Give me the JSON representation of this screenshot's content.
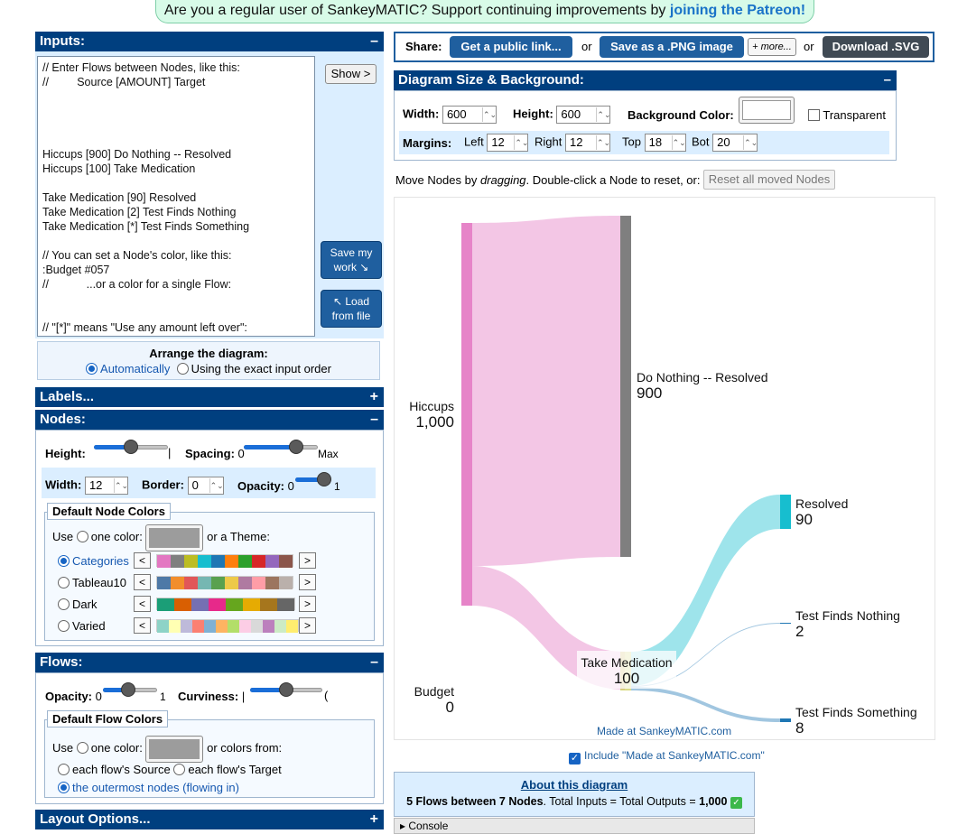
{
  "banner": {
    "prefix": "Are you a regular user of SankeyMATIC? Support continuing improvements by ",
    "link": "joining the Patreon!"
  },
  "inputs": {
    "title": "Inputs:",
    "toggle": "–",
    "flows_text": "// Enter Flows between Nodes, like this:\n//         Source [AMOUNT] Target\n\n\n\n\nHiccups [900] Do Nothing -- Resolved\nHiccups [100] Take Medication\n\nTake Medication [90] Resolved\nTake Medication [2] Test Finds Nothing\nTake Medication [*] Test Finds Something\n\n// You can set a Node's color, like this:\n:Budget #057\n//            ...or a color for a single Flow:\n\n\n// \"[*]\" means \"Use any amount left over\":",
    "show_button": "Show >",
    "save_button": "Save my work ↘",
    "load_button": "↖ Load from file"
  },
  "arrange": {
    "title": "Arrange the diagram:",
    "option_auto": "Automatically",
    "option_exact": "Using the exact input order"
  },
  "labels_panel": {
    "title": "Labels...",
    "toggle": "+"
  },
  "nodes_panel": {
    "title": "Nodes:",
    "toggle": "–",
    "height_label": "Height:",
    "height_value": 0.5,
    "spacing_label": "Spacing:",
    "spacing_min": "0",
    "spacing_max": "Max",
    "spacing_value": 0.75,
    "width_label": "Width:",
    "width_value": "12",
    "border_label": "Border:",
    "border_value": "0",
    "opacity_label": "Opacity:",
    "opacity_min": "0",
    "opacity_max": "1",
    "opacity_value": 1.0,
    "colors_legend": "Default Node Colors",
    "use_label": "Use",
    "one_color_label": "one color:",
    "theme_label": "or a Theme:",
    "themes": [
      {
        "name": "Categories",
        "selected": true,
        "colors": [
          "#e377c2",
          "#7f7f7f",
          "#bcbd22",
          "#17becf",
          "#1f77b4",
          "#ff7f0e",
          "#2ca02c",
          "#d62728",
          "#9467bd",
          "#8c564b"
        ]
      },
      {
        "name": "Tableau10",
        "selected": false,
        "colors": [
          "#4e79a7",
          "#f28e2c",
          "#e15759",
          "#76b7b2",
          "#59a14f",
          "#edc949",
          "#af7aa1",
          "#ff9da7",
          "#9c755f",
          "#bab0ab"
        ]
      },
      {
        "name": "Dark",
        "selected": false,
        "colors": [
          "#1b9e77",
          "#d95f02",
          "#7570b3",
          "#e7298a",
          "#66a61e",
          "#e6ab02",
          "#a6761d",
          "#666666"
        ]
      },
      {
        "name": "Varied",
        "selected": false,
        "colors": [
          "#8dd3c7",
          "#ffffb3",
          "#bebada",
          "#fb8072",
          "#80b1d3",
          "#fdb462",
          "#b3de69",
          "#fccde5",
          "#d9d9d9",
          "#bc80bd",
          "#ccebc5",
          "#ffed6f"
        ]
      }
    ]
  },
  "flows_panel": {
    "title": "Flows:",
    "toggle": "–",
    "opacity_label": "Opacity:",
    "opacity_min": "0",
    "opacity_max": "1",
    "opacity_value": 0.45,
    "curviness_label": "Curviness:",
    "curviness_min": "|",
    "curviness_max": "(",
    "curviness_value": 0.5,
    "colors_legend": "Default Flow Colors",
    "use_label": "Use",
    "one_color_label": "one color:",
    "colors_from_label": "or colors from:",
    "option_source": "each flow's Source",
    "option_target": "each flow's Target",
    "option_outermost": "the outermost nodes (flowing in)"
  },
  "layout_panel": {
    "title": "Layout Options...",
    "toggle": "+"
  },
  "share": {
    "label": "Share:",
    "public_link": "Get a public link...",
    "or1": "or",
    "png": "Save as a .PNG image",
    "more": "+ more...",
    "or2": "or",
    "svg": "Download .SVG"
  },
  "diagram_size": {
    "title": "Diagram Size & Background:",
    "toggle": "–",
    "width_label": "Width:",
    "width_value": "600",
    "height_label": "Height:",
    "height_value": "600",
    "bg_label": "Background Color:",
    "transparent_label": "Transparent",
    "margins_label": "Margins:",
    "left_label": "Left",
    "left_value": "12",
    "right_label": "Right",
    "right_value": "12",
    "top_label": "Top",
    "top_value": "18",
    "bot_label": "Bot",
    "bot_value": "20"
  },
  "move_nodes": {
    "text_before": "Move Nodes by ",
    "text_em": "dragging",
    "text_after": ". Double-click a Node to reset, or:",
    "reset_button": "Reset all moved Nodes"
  },
  "diagram": {
    "nodes": [
      {
        "name": "Hiccups",
        "value": "1,000",
        "color": "#e377c2"
      },
      {
        "name": "Do Nothing -- Resolved",
        "value": "900",
        "color": "#7f7f7f"
      },
      {
        "name": "Take Medication",
        "value": "100",
        "color": "#bcbd22"
      },
      {
        "name": "Resolved",
        "value": "90",
        "color": "#17becf"
      },
      {
        "name": "Test Finds Nothing",
        "value": "2",
        "color": "#1f77b4"
      },
      {
        "name": "Test Finds Something",
        "value": "8",
        "color": "#1f77b4"
      },
      {
        "name": "Budget",
        "value": "0",
        "color": "#005577"
      }
    ],
    "watermark": "Made at SankeyMATIC.com"
  },
  "include_credit": {
    "label": "Include \"Made at SankeyMATIC.com\""
  },
  "about": {
    "title": "About this diagram",
    "summary_bold": "5 Flows between 7 Nodes",
    "summary_rest": ". Total Inputs = Total Outputs = ",
    "total": "1,000",
    "check": "✓"
  },
  "console": {
    "label": "▸ Console"
  }
}
